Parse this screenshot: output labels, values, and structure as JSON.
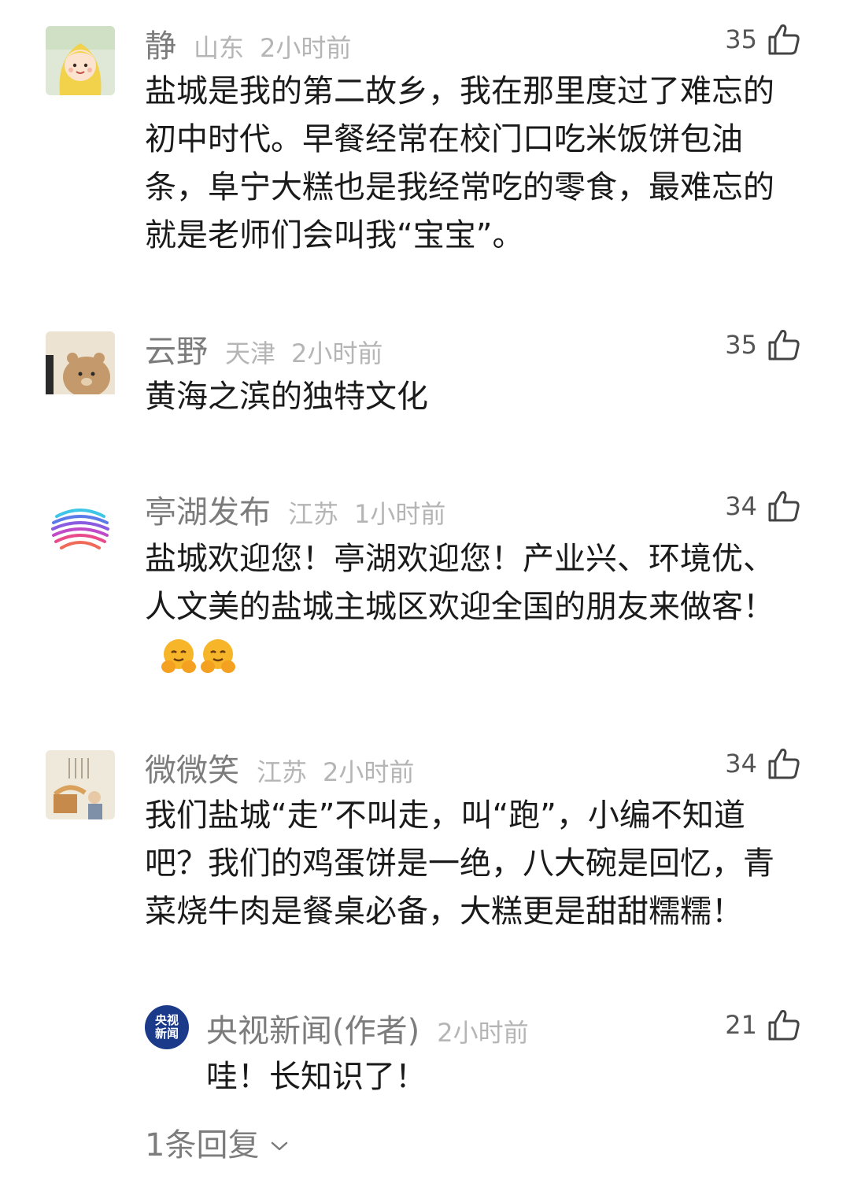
{
  "comments": [
    {
      "name": "静",
      "location": "山东",
      "time": "2小时前",
      "likes": "35",
      "avatar_icon": "girl-raincoat-avatar",
      "text": "盐城是我的第二故乡，我在那里度过了难忘的初中时代。早餐经常在校门口吃米饭饼包油条，阜宁大糕也是我经常吃的零食，最难忘的就是老师们会叫我“宝宝”。"
    },
    {
      "name": "云野",
      "location": "天津",
      "time": "2小时前",
      "likes": "35",
      "avatar_icon": "cartoon-bear-avatar",
      "text": "黄海之滨的独特文化"
    },
    {
      "name": "亭湖发布",
      "location": "江苏",
      "time": "1小时前",
      "likes": "34",
      "avatar_icon": "striped-sphere-logo-avatar",
      "text": "盐城欢迎您！亭湖欢迎您！产业兴、环境优、人文美的盐城主城区欢迎全国的朋友来做客！",
      "emoji_icon": "hugging-face-emoji"
    },
    {
      "name": "微微笑",
      "location": "江苏",
      "time": "2小时前",
      "likes": "34",
      "avatar_icon": "illustration-avatar",
      "text": "我们盐城“走”不叫走，叫“跑”，小编不知道吧？我们的鸡蛋饼是一绝，八大碗是回忆，青菜烧牛肉是餐桌必备，大糕更是甜甜糯糯！"
    }
  ],
  "reply": {
    "name": "央视新闻(作者)",
    "time": "2小时前",
    "likes": "21",
    "avatar_text_line1": "央视",
    "avatar_text_line2": "新闻",
    "text": "哇！长知识了！"
  },
  "more_replies_label": "1条回复",
  "colors": {
    "name": "#7c7c7c",
    "meta": "#b5b5b5",
    "text": "#1a1a1a",
    "cctv_blue": "#1b3a8a"
  }
}
